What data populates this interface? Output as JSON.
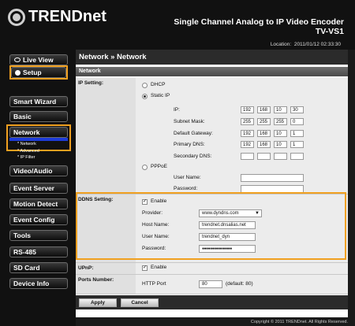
{
  "header": {
    "logo_text": "TRENDnet",
    "product_title": "Single Channel Analog to IP Video Encoder",
    "model": "TV-VS1",
    "location_label": "Location:",
    "location_time": "2011/01/12 02:33:30"
  },
  "sidebar": {
    "live_view": "Live View",
    "setup": "Setup",
    "items": [
      "Smart Wizard",
      "Basic",
      "Network",
      "Video/Audio",
      "Event Server",
      "Motion Detect",
      "Event Config",
      "Tools",
      "RS-485",
      "SD Card",
      "Device Info"
    ],
    "network_sub": [
      "* Network",
      "* Advanced",
      "* IP Filter"
    ]
  },
  "page": {
    "breadcrumb": "Network » Network",
    "section": "Network"
  },
  "ip_setting": {
    "label": "IP Setting:",
    "dhcp": "DHCP",
    "static_ip": "Static IP",
    "ip_label": "IP:",
    "subnet_label": "Subnet Mask:",
    "gateway_label": "Default Gateway:",
    "primary_dns_label": "Primary DNS:",
    "secondary_dns_label": "Secondary DNS:",
    "ip": [
      "192",
      "168",
      "10",
      "30"
    ],
    "subnet": [
      "255",
      "255",
      "255",
      "0"
    ],
    "gateway": [
      "192",
      "168",
      "10",
      "1"
    ],
    "primary_dns": [
      "192",
      "168",
      "10",
      "1"
    ],
    "secondary_dns": [
      "",
      "",
      "",
      ""
    ],
    "pppoe": "PPPoE",
    "user_name_label": "User Name:",
    "password_label": "Password:"
  },
  "ddns": {
    "label": "DDNS Setting:",
    "enable": "Enable",
    "provider_label": "Provider:",
    "provider": "www.dyndns.com",
    "host_label": "Host Name:",
    "host": "trendnet.dnsalias.net",
    "user_label": "User Name:",
    "user": "trendnet_dyn",
    "password_label": "Password:",
    "password": "●●●●●●●●●●●●●●●"
  },
  "upnp": {
    "label": "UPnP:",
    "enable": "Enable"
  },
  "ports": {
    "label": "Ports Number:",
    "http_label": "HTTP Port",
    "http_value": "80",
    "default": "(default: 80)"
  },
  "buttons": {
    "apply": "Apply",
    "cancel": "Cancel"
  },
  "footer": {
    "copyright": "Copyright © 2011 TRENDnet. All Rights Reserved."
  },
  "colors": {
    "highlight": "#f0a020",
    "header_bg": "#111111"
  }
}
